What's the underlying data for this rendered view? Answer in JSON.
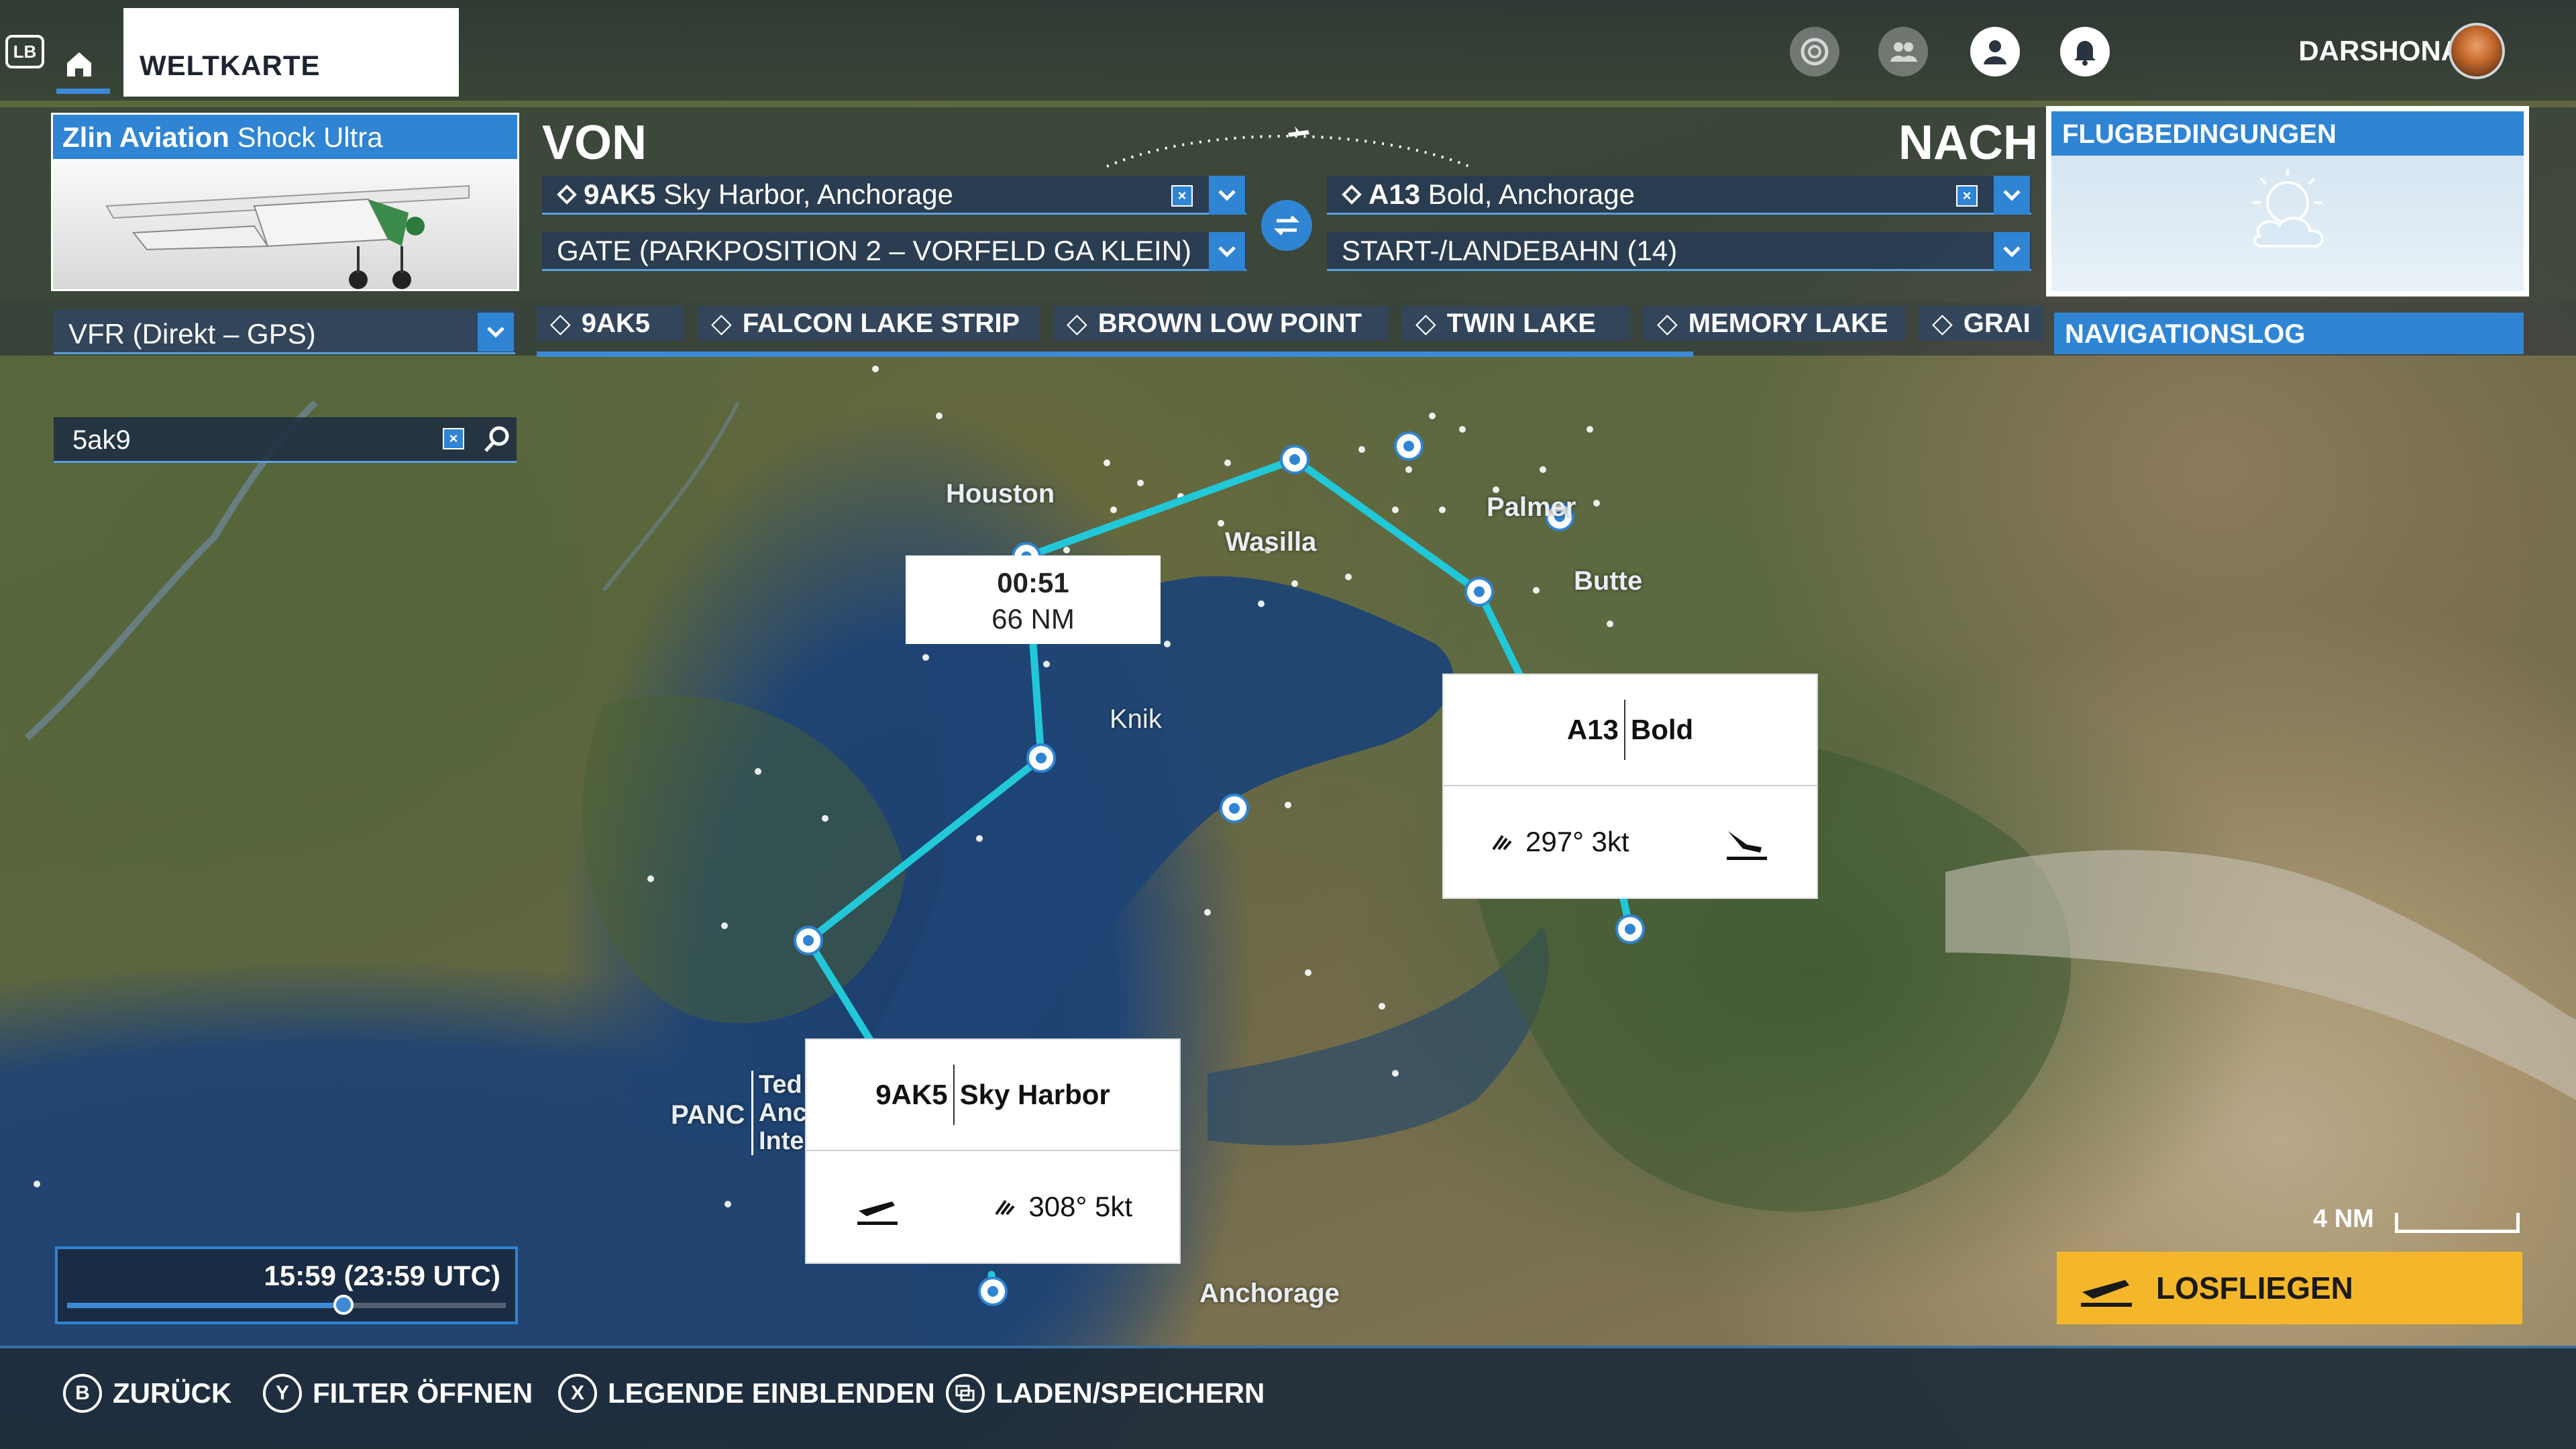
{
  "topbar": {
    "lb_label": "LB",
    "tab_label": "WELTKARTE",
    "username": "DARSHONAUT"
  },
  "aircraft": {
    "brand": "Zlin Aviation",
    "model": "Shock Ultra"
  },
  "from": {
    "heading": "VON",
    "airport_code": "9AK5",
    "airport_name": "Sky Harbor, Anchorage",
    "position": "GATE (PARKPOSITION 2 – VORFELD GA KLEIN)"
  },
  "to": {
    "heading": "NACH",
    "airport_code": "A13",
    "airport_name": "Bold, Anchorage",
    "position": "START-/LANDEBAHN (14)"
  },
  "conditions": {
    "title": "FLUGBEDINGUNGEN"
  },
  "flightplan": {
    "type": "VFR (Direkt – GPS)",
    "waypoints": [
      "9AK5",
      "FALCON LAKE STRIP",
      "BROWN LOW POINT",
      "TWIN LAKE",
      "MEMORY LAKE",
      "GRAI"
    ],
    "navlog": "NAVIGATIONSLOG"
  },
  "search": {
    "value": "5ak9"
  },
  "map": {
    "places": [
      "Houston",
      "Wasilla",
      "Palmer",
      "Butte",
      "Knik",
      "Anchorage"
    ],
    "airport_label": {
      "code": "PANC",
      "lines": [
        "Ted",
        "Anc",
        "Inte"
      ]
    },
    "summary": {
      "time": "00:51",
      "distance": "66 NM"
    },
    "origin_card": {
      "code": "9AK5",
      "name": "Sky Harbor",
      "wind": "308° 5kt"
    },
    "dest_card": {
      "code": "A13",
      "name": "Bold",
      "wind": "297° 3kt"
    },
    "scale": "4 NM"
  },
  "time": {
    "label": "15:59 (23:59 UTC)",
    "progress": 0.63
  },
  "go_button": "LOSFLIEGEN",
  "bottom": [
    {
      "key": "B",
      "label": "ZURÜCK"
    },
    {
      "key": "Y",
      "label": "FILTER ÖFFNEN"
    },
    {
      "key": "X",
      "label": "LEGENDE EINBLENDEN"
    },
    {
      "key": "",
      "label": "LADEN/SPEICHERN"
    }
  ],
  "colors": {
    "accent": "#2f84d3",
    "route": "#21c8d8",
    "go": "#f5b72a"
  }
}
